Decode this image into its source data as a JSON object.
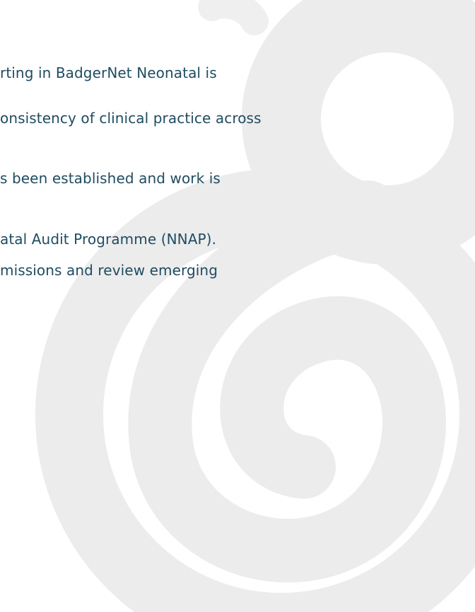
{
  "document": {
    "lines": [
      "rting in BadgerNet Neonatal is",
      "onsistency of clinical practice across",
      "s been established and work is",
      "atal Audit Programme (NNAP).",
      "missions and review emerging"
    ]
  },
  "colors": {
    "text": "#1f4c60",
    "watermark": "#ececec",
    "background": "#ffffff"
  },
  "icons": {
    "watermark": "swirl-logo-watermark"
  }
}
